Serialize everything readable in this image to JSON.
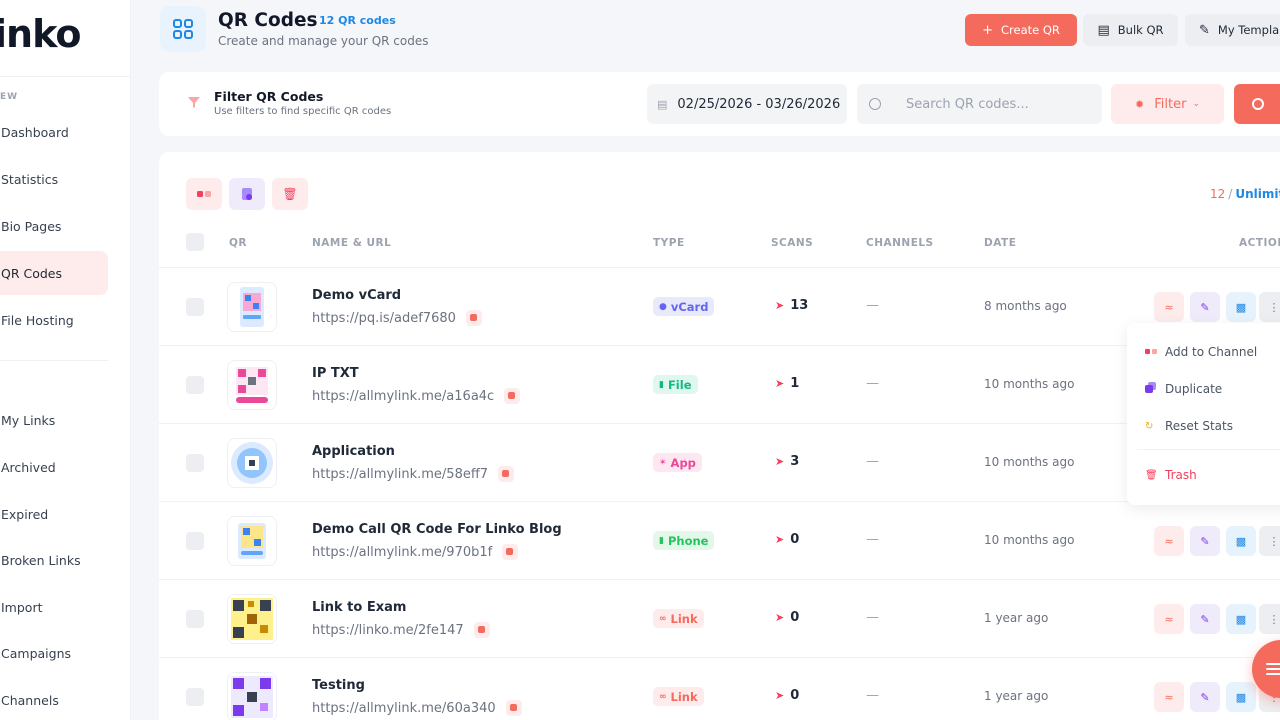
{
  "app": {
    "logo": "inko"
  },
  "sidebar": {
    "section_label": "EW",
    "items": [
      {
        "label": "Dashboard"
      },
      {
        "label": "Statistics"
      },
      {
        "label": "Bio Pages"
      },
      {
        "label": "QR Codes",
        "active": true
      },
      {
        "label": "File Hosting"
      },
      {
        "label": "My Links"
      },
      {
        "label": "Archived"
      },
      {
        "label": "Expired"
      },
      {
        "label": "Broken Links"
      },
      {
        "label": "Import"
      },
      {
        "label": "Campaigns"
      },
      {
        "label": "Channels"
      }
    ]
  },
  "header": {
    "title": "QR Codes",
    "badge": "12 QR codes",
    "subtitle": "Create and manage your QR codes",
    "create_label": "Create QR",
    "bulk_label": "Bulk QR",
    "templates_label": "My Templa"
  },
  "filter": {
    "title": "Filter QR Codes",
    "subtitle": "Use filters to find specific QR codes",
    "date_range": "02/25/2026 - 03/26/2026",
    "search_placeholder": "Search QR codes...",
    "filter_label": "Filter"
  },
  "table": {
    "counter": {
      "count": "12",
      "limit": "Unlimite"
    },
    "columns": {
      "qr": "QR",
      "name": "NAME & URL",
      "type": "TYPE",
      "scans": "SCANS",
      "channels": "CHANNELS",
      "date": "DATE",
      "actions": "ACTION"
    },
    "rows": [
      {
        "name": "Demo vCard",
        "url": "https://pq.is/adef7680",
        "type": "vCard",
        "scans": "13",
        "channels": "—",
        "date": "8 months ago"
      },
      {
        "name": "IP TXT",
        "url": "https://allmylink.me/a16a4c",
        "type": "File",
        "scans": "1",
        "channels": "—",
        "date": "10 months ago"
      },
      {
        "name": "Application",
        "url": "https://allmylink.me/58eff7",
        "type": "App",
        "scans": "3",
        "channels": "—",
        "date": "10 months ago"
      },
      {
        "name": "Demo Call QR Code For Linko Blog",
        "url": "https://allmylink.me/970b1f",
        "type": "Phone",
        "scans": "0",
        "channels": "—",
        "date": "10 months ago"
      },
      {
        "name": "Link to Exam",
        "url": "https://linko.me/2fe147",
        "type": "Link",
        "scans": "0",
        "channels": "—",
        "date": "1 year ago"
      },
      {
        "name": "Testing",
        "url": "https://allmylink.me/60a340",
        "type": "Link",
        "scans": "0",
        "channels": "—",
        "date": "1 year ago"
      }
    ]
  },
  "menu": {
    "add_channel": "Add to Channel",
    "duplicate": "Duplicate",
    "reset_stats": "Reset Stats",
    "trash": "Trash"
  },
  "colors": {
    "accent": "#f46b5d",
    "blue": "#1e88e5",
    "vcard": "#6366f1",
    "file": "#10b981",
    "app": "#ec4899",
    "phone": "#22c55e",
    "link": "#f46b5d"
  }
}
